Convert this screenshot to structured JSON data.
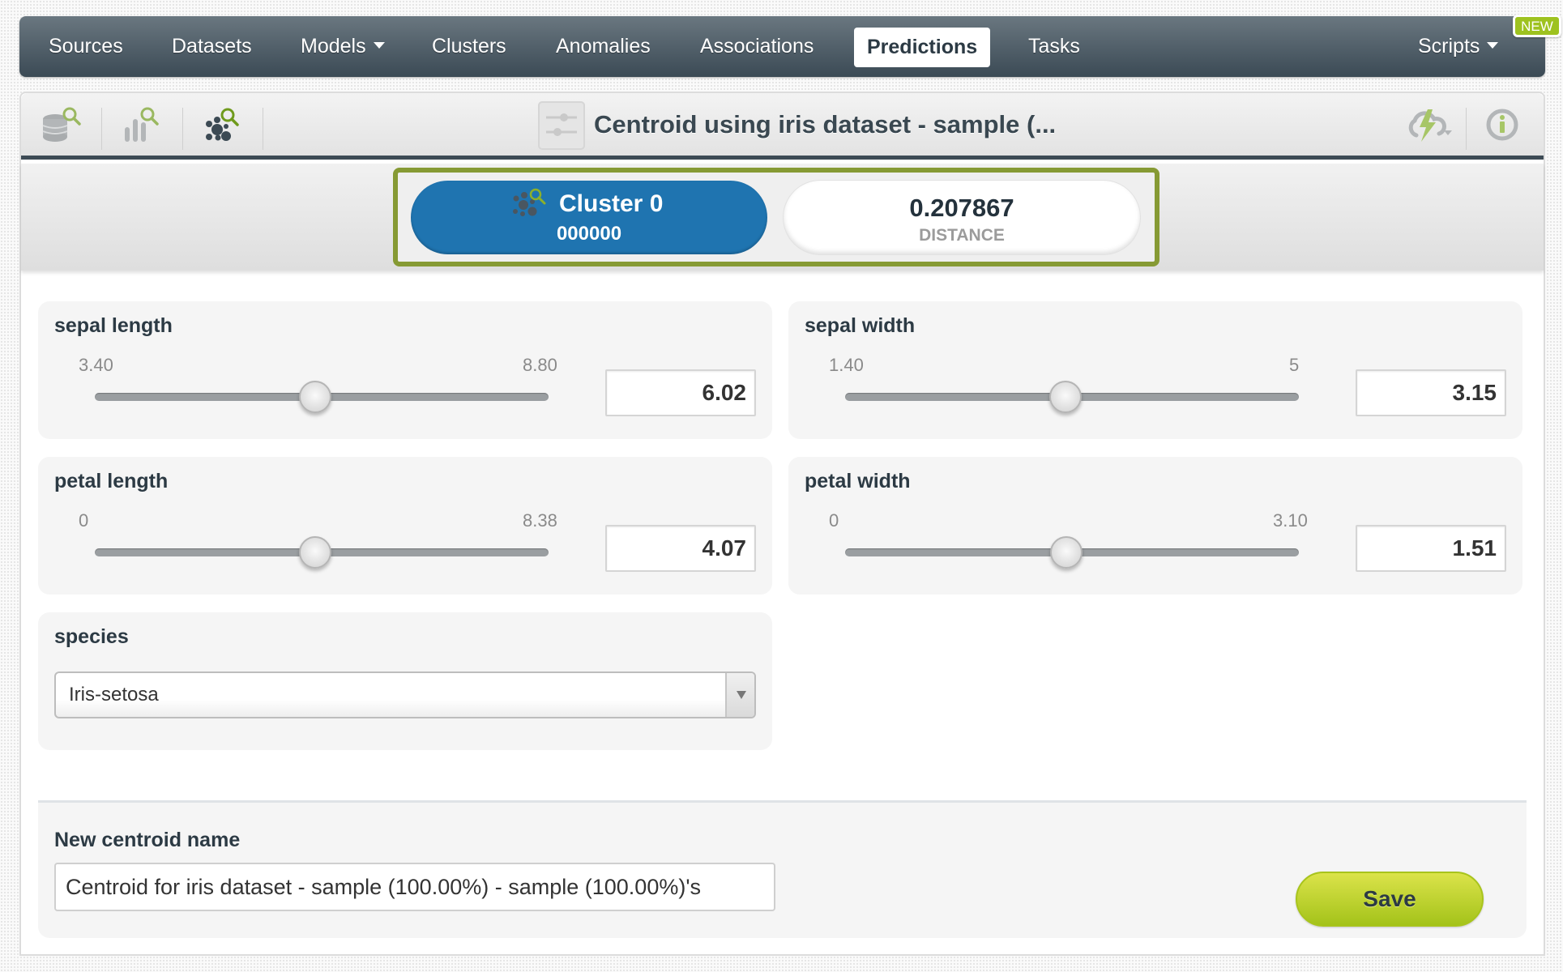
{
  "nav": {
    "items": [
      {
        "label": "Sources"
      },
      {
        "label": "Datasets"
      },
      {
        "label": "Models",
        "dropdown": true
      },
      {
        "label": "Clusters"
      },
      {
        "label": "Anomalies"
      },
      {
        "label": "Associations"
      },
      {
        "label": "Predictions",
        "active": true
      },
      {
        "label": "Tasks"
      },
      {
        "label": "Scripts",
        "dropdown": true
      }
    ],
    "new_badge": "NEW"
  },
  "toolbar": {
    "icons": [
      "dataset-search-icon",
      "model-search-icon",
      "cluster-search-icon"
    ],
    "title": "Centroid using iris dataset - sample (...",
    "title_icon": "centroid-sliders-icon",
    "right_icons": [
      "cloud-lightning-icon",
      "info-icon"
    ]
  },
  "result": {
    "cluster_name": "Cluster 0",
    "cluster_id": "000000",
    "distance_value": "0.207867",
    "distance_label": "DISTANCE",
    "frame_color": "#869a34",
    "cluster_color": "#1f74b0"
  },
  "fields": [
    {
      "label": "sepal length",
      "min": "3.40",
      "max": "8.80",
      "min_num": 3.4,
      "max_num": 8.8,
      "value": "6.02",
      "value_num": 6.02
    },
    {
      "label": "sepal width",
      "min": "1.40",
      "max": "5",
      "min_num": 1.4,
      "max_num": 5,
      "value": "3.15",
      "value_num": 3.15
    },
    {
      "label": "petal length",
      "min": "0",
      "max": "8.38",
      "min_num": 0,
      "max_num": 8.38,
      "value": "4.07",
      "value_num": 4.07
    },
    {
      "label": "petal width",
      "min": "0",
      "max": "3.10",
      "min_num": 0,
      "max_num": 3.1,
      "value": "1.51",
      "value_num": 1.51
    }
  ],
  "species": {
    "label": "species",
    "selected": "Iris-setosa"
  },
  "save_form": {
    "label": "New centroid name",
    "value": "Centroid for iris dataset - sample (100.00%) - sample (100.00%)'s",
    "save_label": "Save",
    "save_color": "#a4c31a"
  }
}
